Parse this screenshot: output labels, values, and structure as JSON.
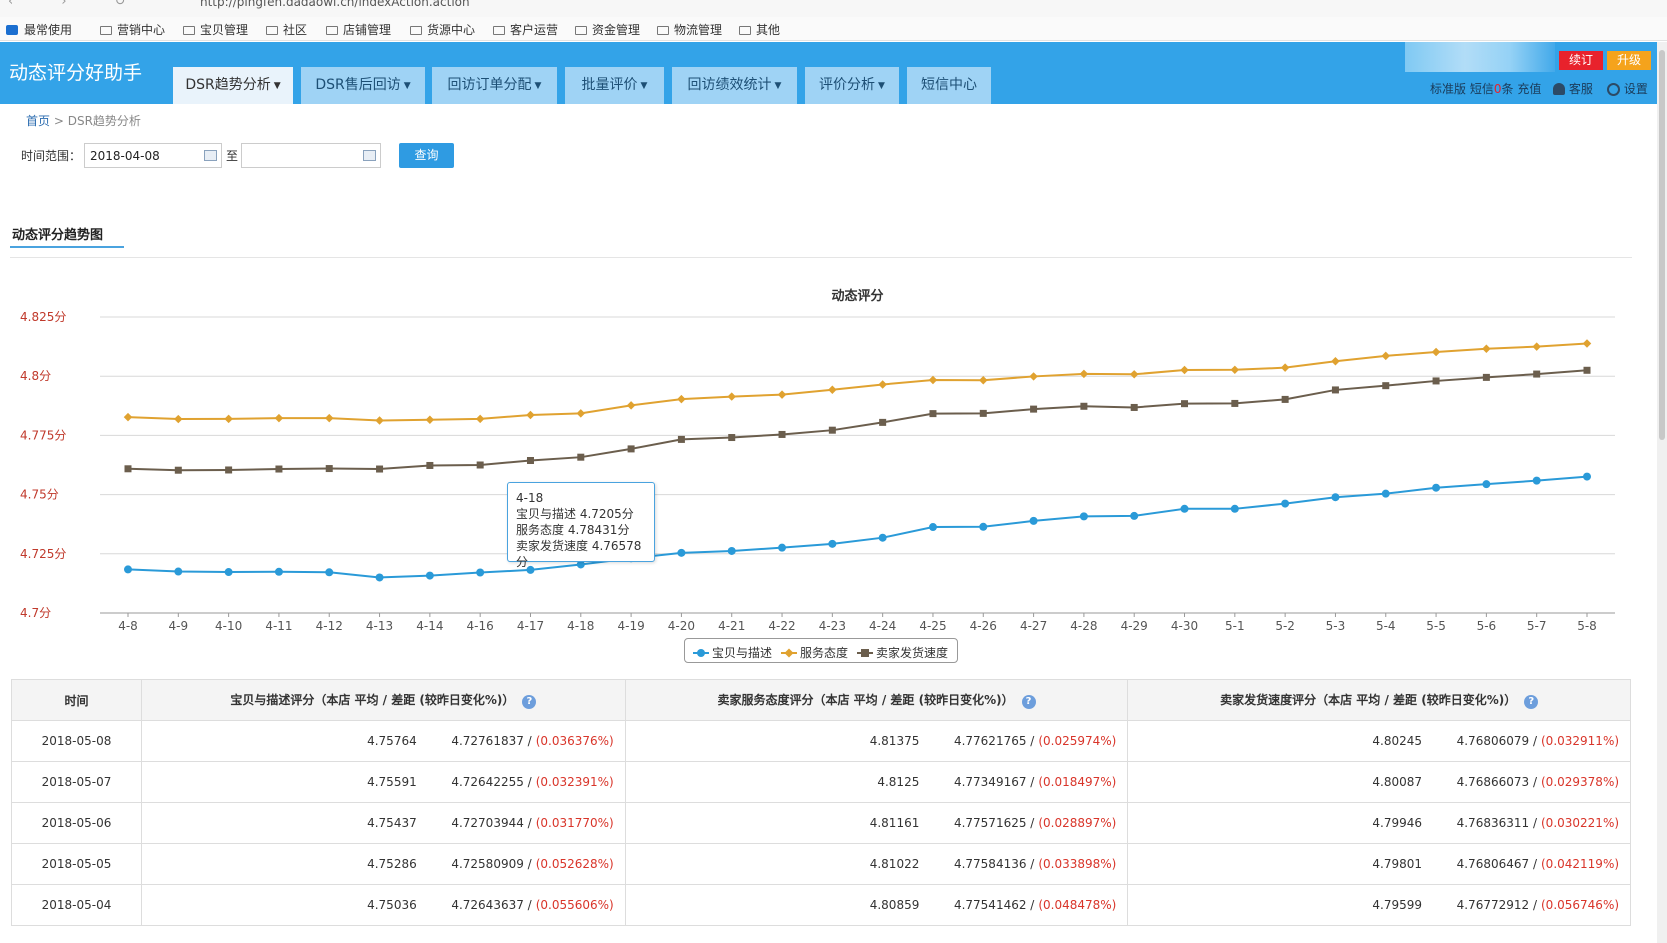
{
  "browser": {
    "url": "http://pingfen.dadaowl.cn/indexAction.action"
  },
  "bookmarks": [
    "最常使用",
    "营销中心",
    "宝贝管理",
    "社区",
    "店铺管理",
    "货源中心",
    "客户运营",
    "资金管理",
    "物流管理",
    "其他"
  ],
  "header": {
    "brand": "动态评分好助手",
    "tabs": [
      "DSR趋势分析",
      "DSR售后回访",
      "回访订单分配",
      "批量评价",
      "回访绩效统计",
      "评价分析",
      "短信中心"
    ],
    "renew": "续订",
    "upgrade": "升级",
    "edition": "标准版",
    "sms_prefix": "短信",
    "sms_count": "0",
    "sms_suffix": "条",
    "recharge": "充值",
    "service": "客服",
    "settings": "设置"
  },
  "breadcrumb": {
    "home": "首页",
    "sep": ">",
    "current": "DSR趋势分析"
  },
  "filter": {
    "label": "时间范围：",
    "start": "2018-04-08",
    "to": "至",
    "end": "",
    "query": "查询"
  },
  "section": {
    "title": "动态评分趋势图"
  },
  "chart_data": {
    "type": "line",
    "title": "动态评分",
    "categories": [
      "4-8",
      "4-9",
      "4-10",
      "4-11",
      "4-12",
      "4-13",
      "4-14",
      "4-16",
      "4-17",
      "4-18",
      "4-19",
      "4-20",
      "4-21",
      "4-22",
      "4-23",
      "4-24",
      "4-25",
      "4-26",
      "4-27",
      "4-28",
      "4-29",
      "4-30",
      "5-1",
      "5-2",
      "5-3",
      "5-4",
      "5-5",
      "5-6",
      "5-7",
      "5-8"
    ],
    "y_ticks": [
      "4.7分",
      "4.725分",
      "4.75分",
      "4.775分",
      "4.8分",
      "4.825分"
    ],
    "ylim": [
      4.7,
      4.825
    ],
    "series": [
      {
        "name": "宝贝与描述",
        "color": "#2a9ad8",
        "marker": "circle",
        "values": [
          4.7184,
          4.7175,
          4.7173,
          4.7174,
          4.7172,
          4.715,
          4.7158,
          4.7171,
          4.7182,
          4.7205,
          4.7231,
          4.7254,
          4.7262,
          4.7276,
          4.7292,
          4.7318,
          4.7363,
          4.7364,
          4.7389,
          4.7408,
          4.741,
          4.744,
          4.744,
          4.7462,
          4.7489,
          4.7504,
          4.7529,
          4.7544,
          4.7559,
          4.7576
        ]
      },
      {
        "name": "服务态度",
        "color": "#e0a230",
        "marker": "diamond",
        "values": [
          4.7827,
          4.7819,
          4.782,
          4.7823,
          4.7823,
          4.7813,
          4.7816,
          4.782,
          4.7836,
          4.7843,
          4.7877,
          4.7903,
          4.7914,
          4.7922,
          4.7943,
          4.7965,
          4.7984,
          4.7983,
          4.7999,
          4.801,
          4.8008,
          4.8026,
          4.8027,
          4.8036,
          4.8063,
          4.8086,
          4.8102,
          4.8116,
          4.8125,
          4.8138
        ]
      },
      {
        "name": "卖家发货速度",
        "color": "#6b5e4d",
        "marker": "square",
        "values": [
          4.7609,
          4.7603,
          4.7604,
          4.7608,
          4.761,
          4.7608,
          4.7623,
          4.7625,
          4.7644,
          4.7658,
          4.7693,
          4.7733,
          4.7741,
          4.7754,
          4.7772,
          4.7805,
          4.7842,
          4.7843,
          4.7861,
          4.7873,
          4.7868,
          4.7884,
          4.7885,
          4.7902,
          4.7942,
          4.796,
          4.798,
          4.7995,
          4.8009,
          4.8025
        ]
      }
    ],
    "legend_position": "bottom-center",
    "grid": true
  },
  "tooltip": {
    "title": "4-18",
    "lines": [
      "宝贝与描述 4.7205分",
      "服务态度 4.78431分",
      "卖家发货速度 4.76578分"
    ]
  },
  "table": {
    "headers": [
      "时间",
      "宝贝与描述评分（本店  平均 / 差距 (较昨日变化%)）",
      "卖家服务态度评分（本店  平均 / 差距 (较昨日变化%)）",
      "卖家发货速度评分（本店  平均 / 差距 (较昨日变化%)）"
    ],
    "help": "?",
    "rows": [
      {
        "date": "2018-05-08",
        "c1": [
          "4.75764",
          "4.72761837 /",
          "(0.036376%)"
        ],
        "c2": [
          "4.81375",
          "4.77621765 /",
          "(0.025974%)"
        ],
        "c3": [
          "4.80245",
          "4.76806079 /",
          "(0.032911%)"
        ]
      },
      {
        "date": "2018-05-07",
        "c1": [
          "4.75591",
          "4.72642255 /",
          "(0.032391%)"
        ],
        "c2": [
          "4.8125",
          "4.77349167 /",
          "(0.018497%)"
        ],
        "c3": [
          "4.80087",
          "4.76866073 /",
          "(0.029378%)"
        ]
      },
      {
        "date": "2018-05-06",
        "c1": [
          "4.75437",
          "4.72703944 /",
          "(0.031770%)"
        ],
        "c2": [
          "4.81161",
          "4.77571625 /",
          "(0.028897%)"
        ],
        "c3": [
          "4.79946",
          "4.76836311 /",
          "(0.030221%)"
        ]
      },
      {
        "date": "2018-05-05",
        "c1": [
          "4.75286",
          "4.72580909 /",
          "(0.052628%)"
        ],
        "c2": [
          "4.81022",
          "4.77584136 /",
          "(0.033898%)"
        ],
        "c3": [
          "4.79801",
          "4.76806467 /",
          "(0.042119%)"
        ]
      },
      {
        "date": "2018-05-04",
        "c1": [
          "4.75036",
          "4.72643637 /",
          "(0.055606%)"
        ],
        "c2": [
          "4.80859",
          "4.77541462 /",
          "(0.048478%)"
        ],
        "c3": [
          "4.79599",
          "4.76772912 /",
          "(0.056746%)"
        ]
      }
    ]
  }
}
